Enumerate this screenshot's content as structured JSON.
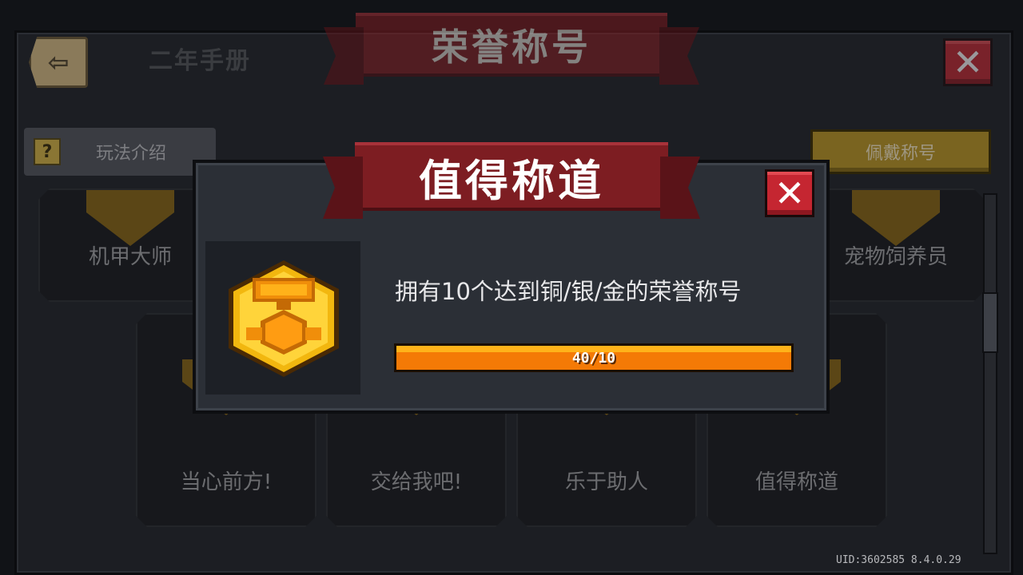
{
  "background": {
    "title": "荣誉称号",
    "help_label": "玩法介绍",
    "wear_title_label": "佩戴称号",
    "cards": [
      "机甲大师",
      "宠物饲养员",
      "当心前方!",
      "交给我吧!",
      "乐于助人",
      "值得称道"
    ],
    "uid": "UID:3602585 8.4.0.29"
  },
  "modal": {
    "title": "值得称道",
    "description": "拥有10个达到铜/银/金的荣誉称号",
    "progress": {
      "current": 40,
      "target": 10,
      "text": "40/10",
      "fraction": 1.0
    },
    "icon": "gold-trophy-medal-icon"
  },
  "icons": {
    "back": "back-arrow-icon",
    "close": "close-icon",
    "help": "question-icon"
  },
  "colors": {
    "ribbon": "#7d1d22",
    "close": "#c52631",
    "progress": "#f47a06",
    "gold": "#f2b70f"
  }
}
